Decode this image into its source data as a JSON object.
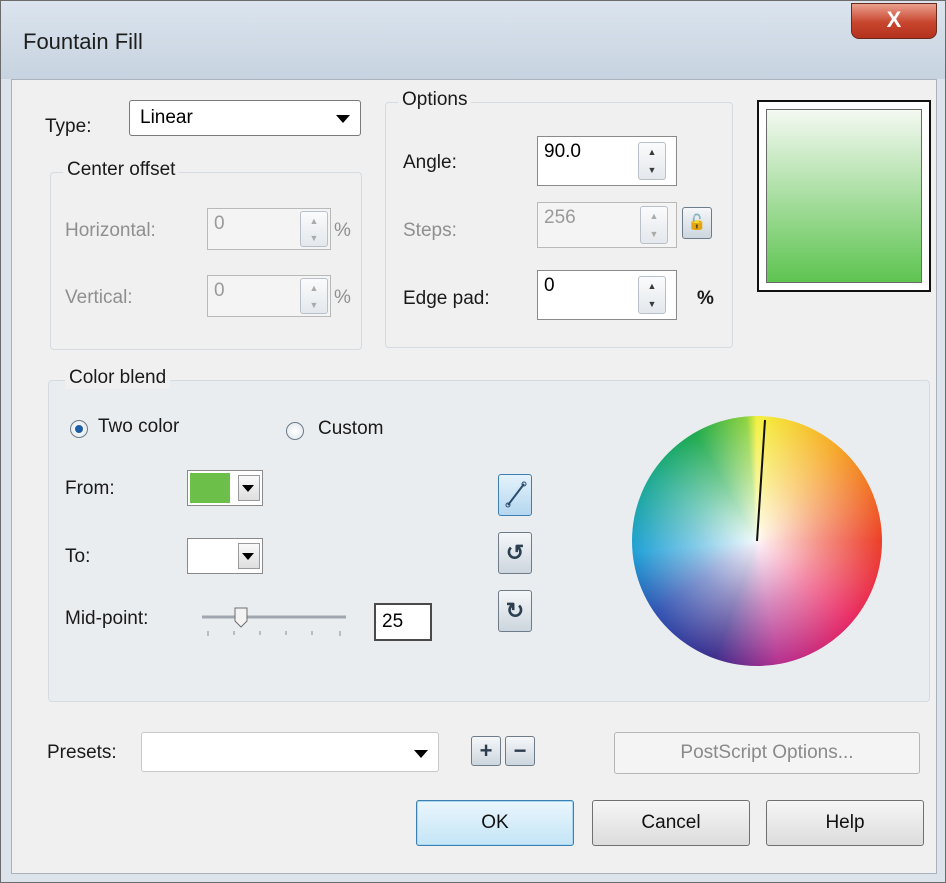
{
  "window": {
    "title": "Fountain Fill",
    "close_label": "X"
  },
  "type": {
    "label": "Type:",
    "value": "Linear"
  },
  "center_offset": {
    "legend": "Center offset",
    "horizontal": {
      "label": "Horizontal:",
      "value": "0",
      "unit": "%"
    },
    "vertical": {
      "label": "Vertical:",
      "value": "0",
      "unit": "%"
    }
  },
  "options": {
    "legend": "Options",
    "angle": {
      "label": "Angle:",
      "value": "90.0"
    },
    "steps": {
      "label": "Steps:",
      "value": "256"
    },
    "edge_pad": {
      "label": "Edge pad:",
      "value": "0",
      "unit": "%"
    }
  },
  "preview": {
    "top_color": "#f4f9f2",
    "bottom_color": "#5ec451"
  },
  "color_blend": {
    "legend": "Color blend",
    "two_color": "Two color",
    "custom": "Custom",
    "selected": "two_color",
    "from": {
      "label": "From:",
      "color": "#6cc04a"
    },
    "to": {
      "label": "To:",
      "color": "#ffffff"
    },
    "midpoint": {
      "label": "Mid-point:",
      "value": "25"
    },
    "direction_buttons": [
      "line-direction-icon",
      "counterclockwise-icon",
      "clockwise-icon"
    ]
  },
  "presets": {
    "label": "Presets:",
    "value": ""
  },
  "buttons": {
    "postscript": "PostScript Options...",
    "ok": "OK",
    "cancel": "Cancel",
    "help": "Help",
    "add_preset_symbol": "+",
    "remove_preset_symbol": "−"
  }
}
